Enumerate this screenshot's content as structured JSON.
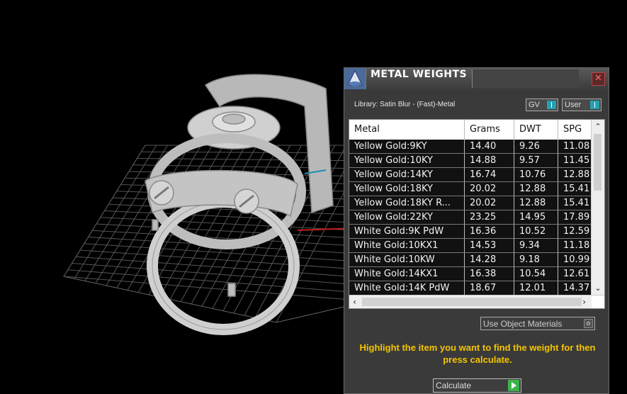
{
  "panel": {
    "title": "METAL WEIGHTS",
    "close_symbol": "✕",
    "library_text": "Library: Satin Blur - (Fast)-Metal",
    "toggle_gv": "GV",
    "toggle_user": "User",
    "use_object_materials": "Use Object Materials",
    "hint": "Highlight the item you want to find the weight for then press calculate.",
    "calculate_label": "Calculate"
  },
  "table": {
    "headers": [
      "Metal",
      "Grams",
      "DWT",
      "SPG"
    ],
    "rows": [
      [
        "Yellow Gold:9KY",
        "14.40",
        "9.26",
        "11.08"
      ],
      [
        "Yellow Gold:10KY",
        "14.88",
        "9.57",
        "11.45"
      ],
      [
        "Yellow Gold:14KY",
        "16.74",
        "10.76",
        "12.88"
      ],
      [
        "Yellow Gold:18KY",
        "20.02",
        "12.88",
        "15.41"
      ],
      [
        "Yellow Gold:18KY R...",
        "20.02",
        "12.88",
        "15.41"
      ],
      [
        "Yellow Gold:22KY",
        "23.25",
        "14.95",
        "17.89"
      ],
      [
        "White Gold:9K PdW",
        "16.36",
        "10.52",
        "12.59"
      ],
      [
        "White Gold:10KX1",
        "14.53",
        "9.34",
        "11.18"
      ],
      [
        "White Gold:10KW",
        "14.28",
        "9.18",
        "10.99"
      ],
      [
        "White Gold:14KX1",
        "16.38",
        "10.54",
        "12.61"
      ],
      [
        "White Gold:14K PdW",
        "18.67",
        "12.01",
        "14.37"
      ]
    ]
  },
  "colors": {
    "accent_toggle": "#27a0b3",
    "hint_text": "#f5c400",
    "calculate_button": "#3bb34a",
    "close_button": "#c04040"
  },
  "icons": {
    "app": "metal-weights-app-icon",
    "close": "close-icon"
  }
}
